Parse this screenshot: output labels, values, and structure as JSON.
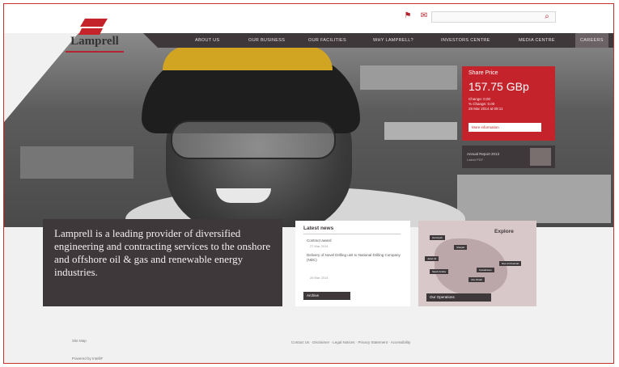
{
  "brand": {
    "name": "Lamprell",
    "accent": "#c4232c",
    "dark": "#3f383b"
  },
  "utility": {
    "icons": [
      "sitemap-icon",
      "mail-icon"
    ],
    "search_placeholder": "",
    "search_icon": "search-icon"
  },
  "nav": {
    "items": [
      "ABOUT US",
      "OUR BUSINESS",
      "OUR FACILITIES",
      "WHY LAMPRELL?",
      "INVESTORS CENTRE",
      "MEDIA CENTRE",
      "CAREERS"
    ],
    "active": "CAREERS"
  },
  "share_price": {
    "title": "Share Price",
    "price": "157.75 GBp",
    "lines": [
      "Change: 0.00",
      "% Change: 0.00",
      "28 Mar 2014 at 09:11"
    ],
    "button": "More information"
  },
  "annual_report": {
    "title": "Annual Report 2013",
    "subtitle": "Latest PDF"
  },
  "intro": "Lamprell is a leading provider of diversified engineering and contracting services to the onshore and offshore oil & gas and renewable energy industries.",
  "news": {
    "title": "Latest news",
    "items": [
      {
        "headline": "Contract award",
        "date": "27 Mar 2014"
      },
      {
        "headline": "Delivery of Novel Drilling unit to National Drilling Company (NDC)",
        "date": "26 Mar 2014"
      }
    ],
    "archive": "Archive"
  },
  "explore": {
    "title": "Explore",
    "pins": [
      "Hamriyah",
      "Sharjah",
      "Jebel Ali",
      "Saudi Arabia",
      "Kazakhstan",
      "Abu Dhabi",
      "Ras Al Khaimah"
    ],
    "button": "Our Operations"
  },
  "footer": {
    "left": [
      "Site Map",
      "Powered by IntelliF"
    ],
    "links": "Contact Us · Disclaimer · Legal Notices · Privacy Statement · Accessibility"
  }
}
